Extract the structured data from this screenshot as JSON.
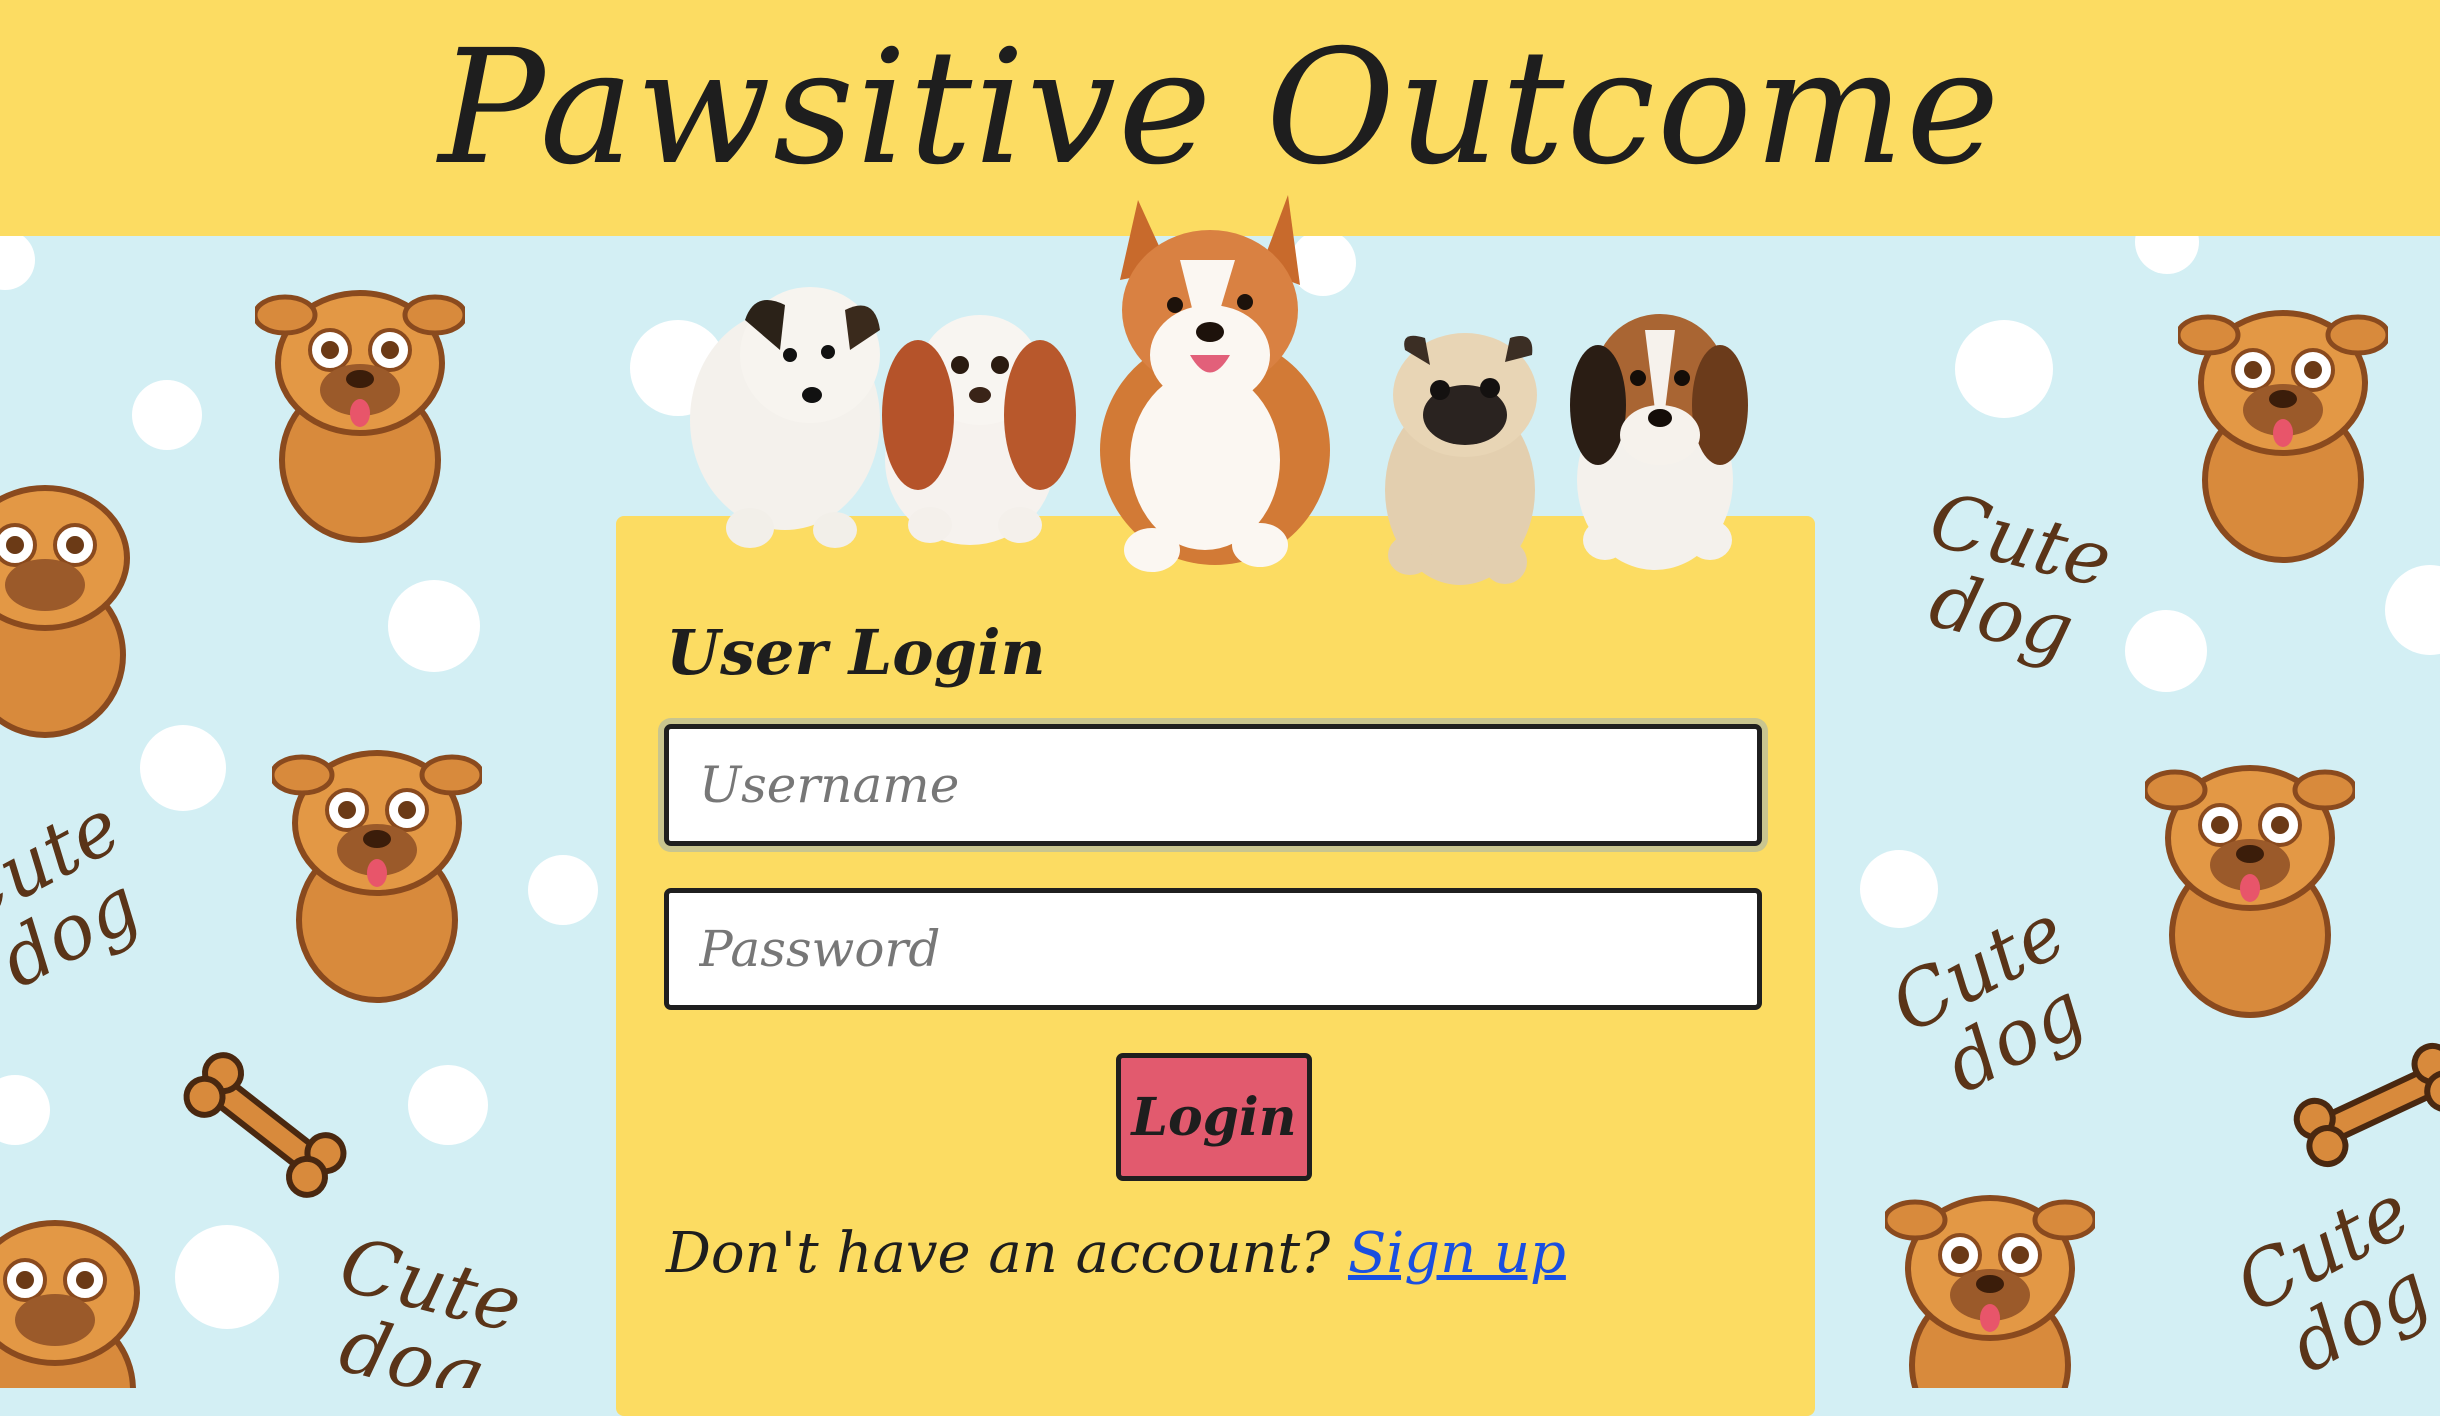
{
  "header": {
    "title": "Pawsitive Outcome"
  },
  "background": {
    "pattern_text_line1": "Cute",
    "pattern_text_line2": "dog"
  },
  "login_card": {
    "title": "User Login",
    "username_placeholder": "Username",
    "password_placeholder": "Password",
    "login_label": "Login",
    "no_account_text": "Don't have an account?",
    "signup_label": "Sign up"
  },
  "colors": {
    "header_bg": "#fcdc62",
    "page_bg": "#d3eff4",
    "button_bg": "#e25a6e",
    "link": "#1a4fe0"
  }
}
